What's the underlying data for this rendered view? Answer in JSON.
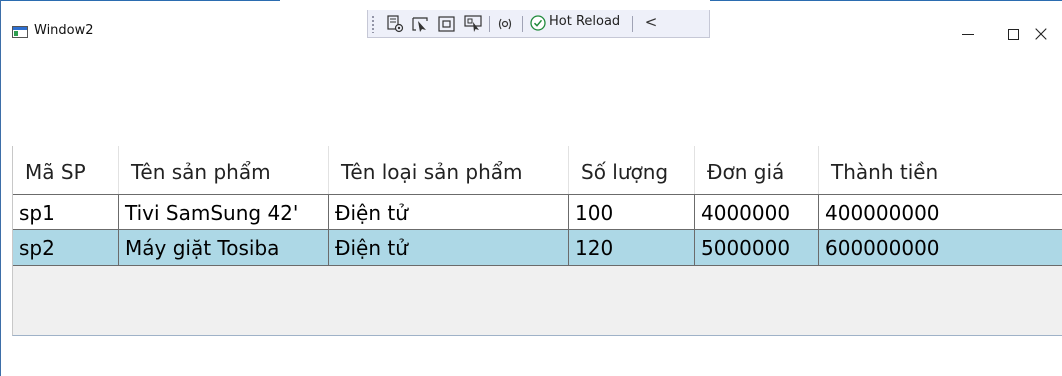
{
  "window": {
    "title": "Window2"
  },
  "debug_toolbar": {
    "hot_reload_label": "Hot Reload",
    "collapse_glyph": "<",
    "icons": [
      "live-visual-tree-icon",
      "select-element-icon",
      "display-layout-adorners-icon",
      "track-focused-element-icon",
      "binding-failures-icon",
      "hot-reload-check-icon"
    ]
  },
  "window_controls": {
    "close_glyph": "×"
  },
  "grid": {
    "columns": [
      "Mã SP",
      "Tên sản phẩm",
      "Tên loại sản phẩm",
      "Số lượng",
      "Đơn giá",
      "Thành tiền"
    ],
    "rows": [
      [
        "sp1",
        "Tivi SamSung 42'",
        "Điện tử",
        "100",
        "4000000",
        "400000000"
      ],
      [
        "sp2",
        "Máy giặt Tosiba",
        "Điện tử",
        "120",
        "5000000",
        "600000000"
      ]
    ],
    "selected_row_color": "#add8e6"
  }
}
